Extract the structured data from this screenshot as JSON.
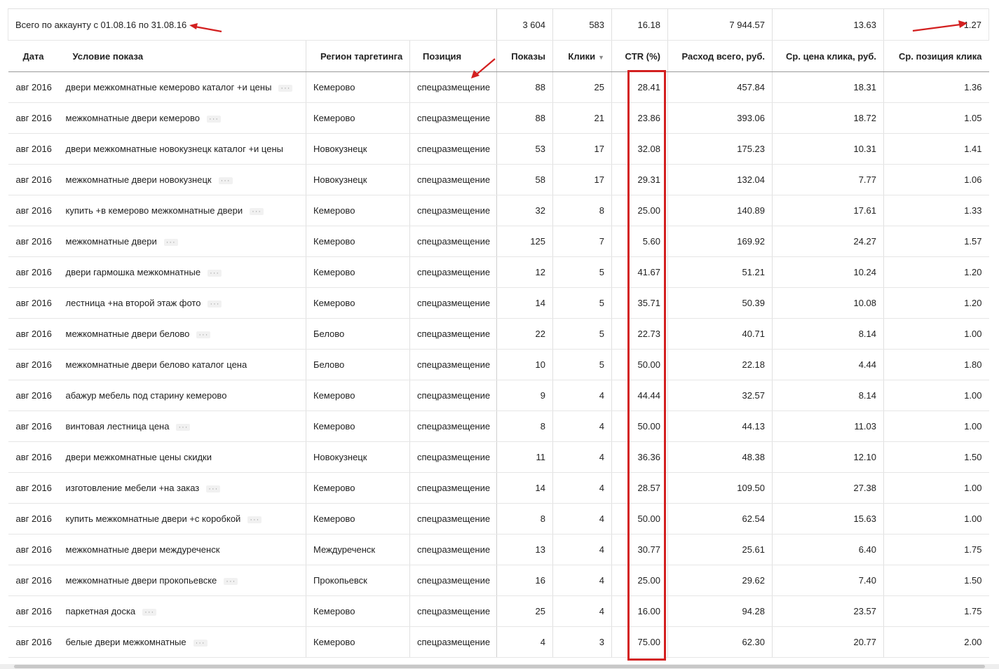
{
  "totals": {
    "label": "Всего по аккаунту с 01.08.16 по 31.08.16",
    "impressions": "3 604",
    "clicks": "583",
    "ctr": "16.18",
    "spend": "7 944.57",
    "avg_cpc": "13.63",
    "avg_position": "1.27"
  },
  "columns": {
    "date": "Дата",
    "condition": "Условие показа",
    "region": "Регион таргетинга",
    "position": "Позиция",
    "impressions": "Показы",
    "clicks": "Клики",
    "clicks_sort_icon": "▼",
    "ctr": "CTR (%)",
    "spend": "Расход всего, руб.",
    "avg_cpc": "Ср. цена клика, руб.",
    "avg_position": "Ср. позиция клика"
  },
  "more_glyph": "···",
  "rows": [
    {
      "date": "авг 2016",
      "condition": "двери межкомнатные кемерово каталог +и цены",
      "more": true,
      "region": "Кемерово",
      "position": "спецразмещение",
      "impressions": "88",
      "clicks": "25",
      "ctr": "28.41",
      "spend": "457.84",
      "avg_cpc": "18.31",
      "avg_position": "1.36"
    },
    {
      "date": "авг 2016",
      "condition": "межкомнатные двери кемерово",
      "more": true,
      "region": "Кемерово",
      "position": "спецразмещение",
      "impressions": "88",
      "clicks": "21",
      "ctr": "23.86",
      "spend": "393.06",
      "avg_cpc": "18.72",
      "avg_position": "1.05"
    },
    {
      "date": "авг 2016",
      "condition": "двери межкомнатные новокузнецк каталог +и цены",
      "more": false,
      "region": "Новокузнецк",
      "position": "спецразмещение",
      "impressions": "53",
      "clicks": "17",
      "ctr": "32.08",
      "spend": "175.23",
      "avg_cpc": "10.31",
      "avg_position": "1.41"
    },
    {
      "date": "авг 2016",
      "condition": "межкомнатные двери новокузнецк",
      "more": true,
      "region": "Новокузнецк",
      "position": "спецразмещение",
      "impressions": "58",
      "clicks": "17",
      "ctr": "29.31",
      "spend": "132.04",
      "avg_cpc": "7.77",
      "avg_position": "1.06"
    },
    {
      "date": "авг 2016",
      "condition": "купить +в кемерово межкомнатные двери",
      "more": true,
      "region": "Кемерово",
      "position": "спецразмещение",
      "impressions": "32",
      "clicks": "8",
      "ctr": "25.00",
      "spend": "140.89",
      "avg_cpc": "17.61",
      "avg_position": "1.33"
    },
    {
      "date": "авг 2016",
      "condition": "межкомнатные двери",
      "more": true,
      "region": "Кемерово",
      "position": "спецразмещение",
      "impressions": "125",
      "clicks": "7",
      "ctr": "5.60",
      "spend": "169.92",
      "avg_cpc": "24.27",
      "avg_position": "1.57"
    },
    {
      "date": "авг 2016",
      "condition": "двери гармошка межкомнатные",
      "more": true,
      "region": "Кемерово",
      "position": "спецразмещение",
      "impressions": "12",
      "clicks": "5",
      "ctr": "41.67",
      "spend": "51.21",
      "avg_cpc": "10.24",
      "avg_position": "1.20"
    },
    {
      "date": "авг 2016",
      "condition": "лестница +на второй этаж фото",
      "more": true,
      "region": "Кемерово",
      "position": "спецразмещение",
      "impressions": "14",
      "clicks": "5",
      "ctr": "35.71",
      "spend": "50.39",
      "avg_cpc": "10.08",
      "avg_position": "1.20"
    },
    {
      "date": "авг 2016",
      "condition": "межкомнатные двери белово",
      "more": true,
      "region": "Белово",
      "position": "спецразмещение",
      "impressions": "22",
      "clicks": "5",
      "ctr": "22.73",
      "spend": "40.71",
      "avg_cpc": "8.14",
      "avg_position": "1.00"
    },
    {
      "date": "авг 2016",
      "condition": "межкомнатные двери белово каталог цена",
      "more": false,
      "region": "Белово",
      "position": "спецразмещение",
      "impressions": "10",
      "clicks": "5",
      "ctr": "50.00",
      "spend": "22.18",
      "avg_cpc": "4.44",
      "avg_position": "1.80"
    },
    {
      "date": "авг 2016",
      "condition": "абажур мебель под старину кемерово",
      "more": false,
      "region": "Кемерово",
      "position": "спецразмещение",
      "impressions": "9",
      "clicks": "4",
      "ctr": "44.44",
      "spend": "32.57",
      "avg_cpc": "8.14",
      "avg_position": "1.00"
    },
    {
      "date": "авг 2016",
      "condition": "винтовая лестница цена",
      "more": true,
      "region": "Кемерово",
      "position": "спецразмещение",
      "impressions": "8",
      "clicks": "4",
      "ctr": "50.00",
      "spend": "44.13",
      "avg_cpc": "11.03",
      "avg_position": "1.00"
    },
    {
      "date": "авг 2016",
      "condition": "двери межкомнатные цены скидки",
      "more": false,
      "region": "Новокузнецк",
      "position": "спецразмещение",
      "impressions": "11",
      "clicks": "4",
      "ctr": "36.36",
      "spend": "48.38",
      "avg_cpc": "12.10",
      "avg_position": "1.50"
    },
    {
      "date": "авг 2016",
      "condition": "изготовление мебели +на заказ",
      "more": true,
      "region": "Кемерово",
      "position": "спецразмещение",
      "impressions": "14",
      "clicks": "4",
      "ctr": "28.57",
      "spend": "109.50",
      "avg_cpc": "27.38",
      "avg_position": "1.00"
    },
    {
      "date": "авг 2016",
      "condition": "купить межкомнатные двери +с коробкой",
      "more": true,
      "region": "Кемерово",
      "position": "спецразмещение",
      "impressions": "8",
      "clicks": "4",
      "ctr": "50.00",
      "spend": "62.54",
      "avg_cpc": "15.63",
      "avg_position": "1.00"
    },
    {
      "date": "авг 2016",
      "condition": "межкомнатные двери междуреченск",
      "more": false,
      "region": "Междуреченск",
      "position": "спецразмещение",
      "impressions": "13",
      "clicks": "4",
      "ctr": "30.77",
      "spend": "25.61",
      "avg_cpc": "6.40",
      "avg_position": "1.75"
    },
    {
      "date": "авг 2016",
      "condition": "межкомнатные двери прокопьевске",
      "more": true,
      "region": "Прокопьевск",
      "position": "спецразмещение",
      "impressions": "16",
      "clicks": "4",
      "ctr": "25.00",
      "spend": "29.62",
      "avg_cpc": "7.40",
      "avg_position": "1.50"
    },
    {
      "date": "авг 2016",
      "condition": "паркетная доска",
      "more": true,
      "region": "Кемерово",
      "position": "спецразмещение",
      "impressions": "25",
      "clicks": "4",
      "ctr": "16.00",
      "spend": "94.28",
      "avg_cpc": "23.57",
      "avg_position": "1.75"
    },
    {
      "date": "авг 2016",
      "condition": "белые двери межкомнатные",
      "more": true,
      "region": "Кемерово",
      "position": "спецразмещение",
      "impressions": "4",
      "clicks": "3",
      "ctr": "75.00",
      "spend": "62.30",
      "avg_cpc": "20.77",
      "avg_position": "2.00"
    }
  ],
  "colors": {
    "annotation_red": "#d32020",
    "header_border": "#9a9a9a",
    "row_border": "#e6e6e6"
  }
}
